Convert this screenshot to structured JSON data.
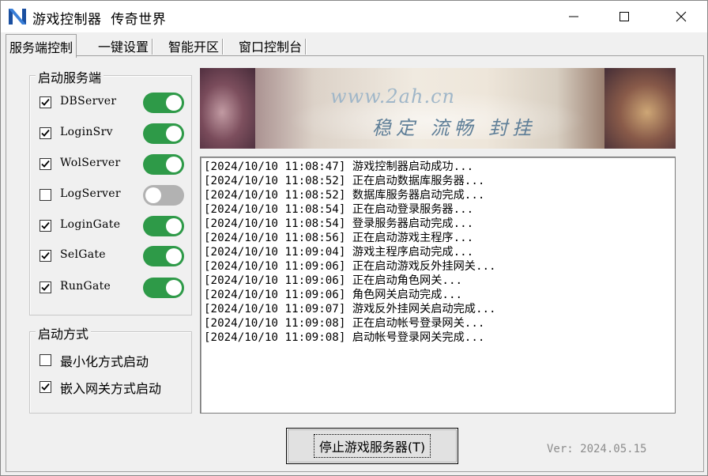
{
  "window": {
    "title": "游戏控制器  传奇世界",
    "icon": "app-logo-icon"
  },
  "tabs": [
    {
      "label": "服务端控制",
      "active": true
    },
    {
      "label": "一键设置",
      "active": false
    },
    {
      "label": "智能开区",
      "active": false
    },
    {
      "label": "窗口控制台",
      "active": false
    }
  ],
  "servers_group": {
    "title": "启动服务端",
    "items": [
      {
        "name": "DBServer",
        "checked": true,
        "running": true
      },
      {
        "name": "LoginSrv",
        "checked": true,
        "running": true
      },
      {
        "name": "WolServer",
        "checked": true,
        "running": true
      },
      {
        "name": "LogServer",
        "checked": false,
        "running": false
      },
      {
        "name": "LoginGate",
        "checked": true,
        "running": true
      },
      {
        "name": "SelGate",
        "checked": true,
        "running": true
      },
      {
        "name": "RunGate",
        "checked": true,
        "running": true
      }
    ]
  },
  "start_mode_group": {
    "title": "启动方式",
    "options": [
      {
        "label": "最小化方式启动",
        "checked": false
      },
      {
        "label": "嵌入网关方式启动",
        "checked": true
      }
    ]
  },
  "banner": {
    "url": "www.2ah.cn",
    "slogan": "稳定 流畅 封挂"
  },
  "log": [
    "[2024/10/10 11:08:47] 游戏控制器启动成功...",
    "[2024/10/10 11:08:52] 正在启动数据库服务器...",
    "[2024/10/10 11:08:52] 数据库服务器启动完成...",
    "[2024/10/10 11:08:54] 正在启动登录服务器...",
    "[2024/10/10 11:08:54] 登录服务器启动完成...",
    "[2024/10/10 11:08:56] 正在启动游戏主程序...",
    "[2024/10/10 11:09:04] 游戏主程序启动完成...",
    "[2024/10/10 11:09:06] 正在启动游戏反外挂网关...",
    "[2024/10/10 11:09:06] 正在启动角色网关...",
    "[2024/10/10 11:09:06] 角色网关启动完成...",
    "[2024/10/10 11:09:07] 游戏反外挂网关启动完成...",
    "[2024/10/10 11:09:08] 正在启动帐号登录网关...",
    "[2024/10/10 11:09:08] 启动帐号登录网关完成..."
  ],
  "buttons": {
    "stop_server": "停止游戏服务器(T)"
  },
  "version": "Ver: 2024.05.15",
  "colors": {
    "toggle_on": "#2e9a48",
    "toggle_off": "#b2b2b2",
    "logo_blue": "#1a4fa0"
  }
}
